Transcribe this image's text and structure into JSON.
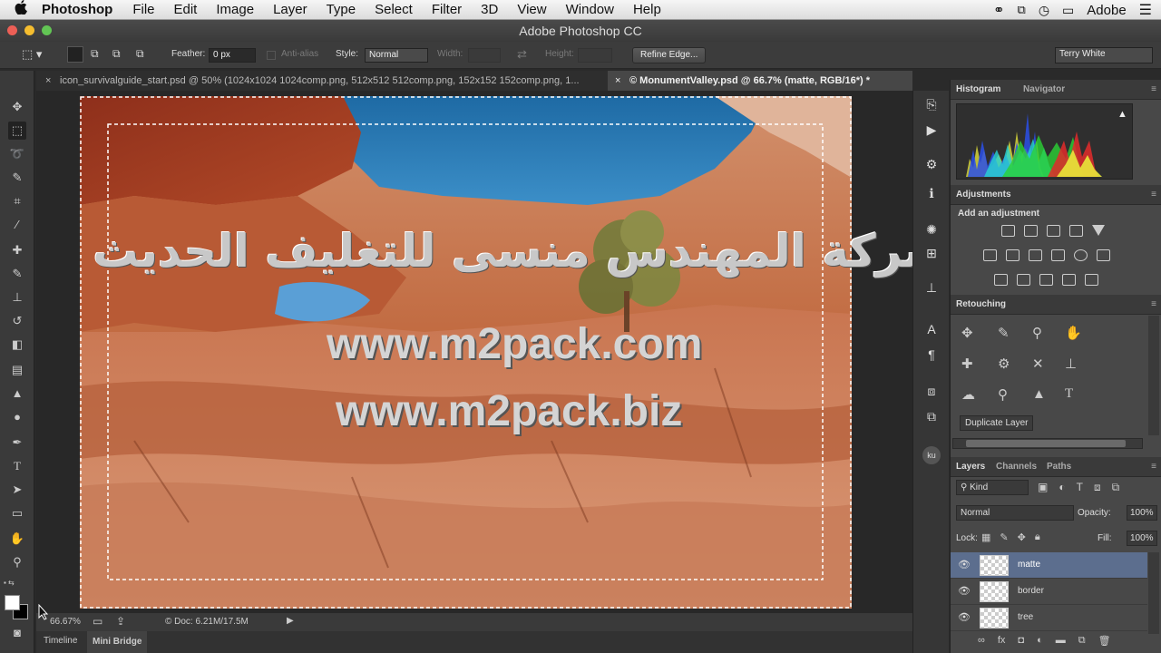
{
  "menubar": {
    "apple": "",
    "app_name": "Photoshop",
    "menus": [
      "File",
      "Edit",
      "Image",
      "Layer",
      "Type",
      "Select",
      "Filter",
      "3D",
      "View",
      "Window",
      "Help"
    ],
    "adobe": "Adobe"
  },
  "window": {
    "title": "Adobe Photoshop CC"
  },
  "options": {
    "feather_label": "Feather:",
    "feather_value": "0 px",
    "antialias_label": "Anti-alias",
    "style_label": "Style:",
    "style_value": "Normal",
    "width_label": "Width:",
    "height_label": "Height:",
    "refine_edge": "Refine Edge...",
    "workspace": "Terry White"
  },
  "tabs": [
    {
      "label": "icon_survivalguide_start.psd @ 50% (1024x1024 1024comp.png, 512x512 512comp.png, 152x152 152comp.png, 1...",
      "close": "×"
    },
    {
      "label": "© MonumentValley.psd @ 66.7% (matte, RGB/16*) *",
      "close": "×"
    }
  ],
  "watermark": {
    "arabic": "شركة المهندس منسى للتغليف الحديث",
    "url1": "www.m2pack.com",
    "url2": "www.m2pack.biz"
  },
  "status": {
    "zoom": "66.67%",
    "doc": "© Doc: 6.21M/17.5M"
  },
  "bottom_tabs": [
    "Timeline",
    "Mini Bridge"
  ],
  "panels": {
    "histogram_tab": "Histogram",
    "navigator_tab": "Navigator",
    "warning": "▲",
    "adjustments_title": "Adjustments",
    "add_adjustment": "Add an adjustment",
    "retouching_title": "Retouching",
    "duplicate_layer": "Duplicate Layer",
    "layers_tab": "Layers",
    "channels_tab": "Channels",
    "paths_tab": "Paths",
    "kind_label": "Kind",
    "blend_mode": "Normal",
    "opacity_label": "Opacity:",
    "opacity_value": "100%",
    "lock_label": "Lock:",
    "fill_label": "Fill:",
    "fill_value": "100%",
    "layers": [
      {
        "name": "matte",
        "selected": true
      },
      {
        "name": "border",
        "selected": false
      },
      {
        "name": "tree",
        "selected": false
      }
    ],
    "ku_label": "ku"
  },
  "colors": {
    "accent": "#5c6e8e",
    "sky": "#2e7db6",
    "rock": "#b4532e"
  }
}
